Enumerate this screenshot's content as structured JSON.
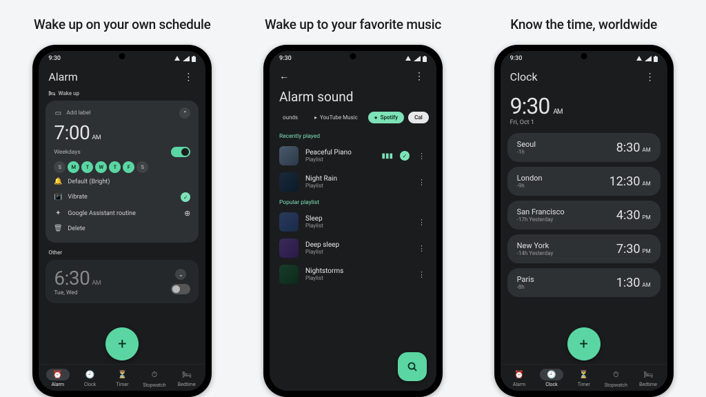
{
  "captions": [
    "Wake up on your own schedule",
    "Wake up to your favorite music",
    "Know the time, worldwide"
  ],
  "status_time": "9:30",
  "screen1": {
    "title": "Alarm",
    "section_wakeup": "Wake up",
    "add_label": "Add label",
    "time": "7:00",
    "ampm": "AM",
    "weekdays_label": "Weekdays",
    "days": [
      "S",
      "M",
      "T",
      "W",
      "T",
      "F",
      "S"
    ],
    "days_on": [
      false,
      true,
      true,
      true,
      true,
      true,
      false
    ],
    "sound": "Default (Bright)",
    "vibrate": "Vibrate",
    "assistant": "Google Assistant routine",
    "delete": "Delete",
    "section_other": "Other",
    "time2": "6:30",
    "ampm2": "AM",
    "days2_label": "Tue, Wed",
    "nav": [
      "Alarm",
      "Clock",
      "Timer",
      "Stopwatch",
      "Bedtime"
    ]
  },
  "screen2": {
    "title": "Alarm sound",
    "chips": [
      "ounds",
      "YouTube Music",
      "Spotify",
      "Cal"
    ],
    "sec_recent": "Recently played",
    "sec_popular": "Popular playlist",
    "tracks_recent": [
      {
        "t": "Peaceful Piano",
        "s": "Playlist",
        "playing": true
      },
      {
        "t": "Night Rain",
        "s": "Playlist",
        "playing": false
      }
    ],
    "tracks_popular": [
      {
        "t": "Sleep",
        "s": "Playlist"
      },
      {
        "t": "Deep sleep",
        "s": "Playlist"
      },
      {
        "t": "Nightstorms",
        "s": "Playlist"
      }
    ]
  },
  "screen3": {
    "title": "Clock",
    "time": "9:30",
    "ampm": "AM",
    "date": "Fri, Oct 1",
    "cities": [
      {
        "n": "Seoul",
        "o": "-1h",
        "tm": "8:30",
        "ap": "AM"
      },
      {
        "n": "London",
        "o": "-9h",
        "tm": "12:30",
        "ap": "AM"
      },
      {
        "n": "San Francisco",
        "o": "-17h  Yesterday",
        "tm": "4:30",
        "ap": "PM"
      },
      {
        "n": "New York",
        "o": "-14h  Yesterday",
        "tm": "7:30",
        "ap": "PM"
      },
      {
        "n": "Paris",
        "o": "-8h",
        "tm": "1:30",
        "ap": "AM"
      }
    ],
    "nav": [
      "Alarm",
      "Clock",
      "Timer",
      "Stopwatch",
      "Bedtime"
    ]
  }
}
